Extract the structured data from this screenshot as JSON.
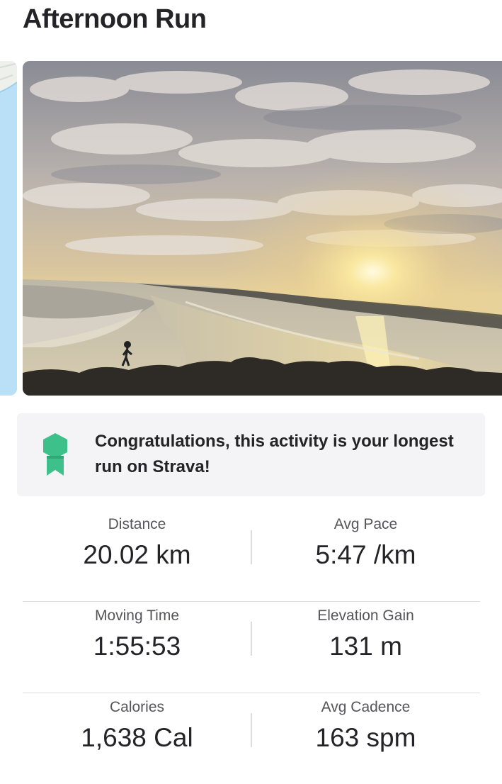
{
  "activity": {
    "title": "Afternoon Run"
  },
  "media": {
    "photo_description": "beach-sunset-photo"
  },
  "achievement": {
    "icon": "achievement-badge-icon",
    "color": "#3ec08a",
    "text": "Congratulations, this activity is your longest run on Strava!"
  },
  "stats": [
    {
      "label": "Distance",
      "value": "20.02 km"
    },
    {
      "label": "Avg Pace",
      "value": "5:47 /km"
    },
    {
      "label": "Moving Time",
      "value": "1:55:53"
    },
    {
      "label": "Elevation Gain",
      "value": "131 m"
    },
    {
      "label": "Calories",
      "value": "1,638 Cal"
    },
    {
      "label": "Avg Cadence",
      "value": "163 spm"
    }
  ]
}
